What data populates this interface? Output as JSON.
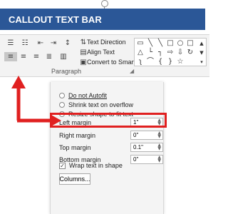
{
  "callout": {
    "title": "CALLOUT TEXT BAR"
  },
  "ribbon": {
    "text_direction": "Text Direction",
    "align_text": "Align Text",
    "convert_smartart": "Convert to SmartArt",
    "group_label": "Paragraph"
  },
  "panel": {
    "options": {
      "do_not_autofit": "Do not Autofit",
      "shrink_text": "Shrink text on overflow",
      "resize_shape": "Resize shape to fit text"
    },
    "margins": {
      "left_label": "Left margin",
      "left_value": "1\"",
      "right_label": "Right margin",
      "right_value": "0\"",
      "top_label": "Top margin",
      "top_value": "0.1\"",
      "bottom_label": "Bottom margin",
      "bottom_value": "0\""
    },
    "wrap_label": "Wrap text in shape",
    "columns_label": "Columns..."
  },
  "colors": {
    "callout_bg": "#2b5797",
    "highlight": "#e02020",
    "ribbon_bg": "#f3f3f3"
  }
}
